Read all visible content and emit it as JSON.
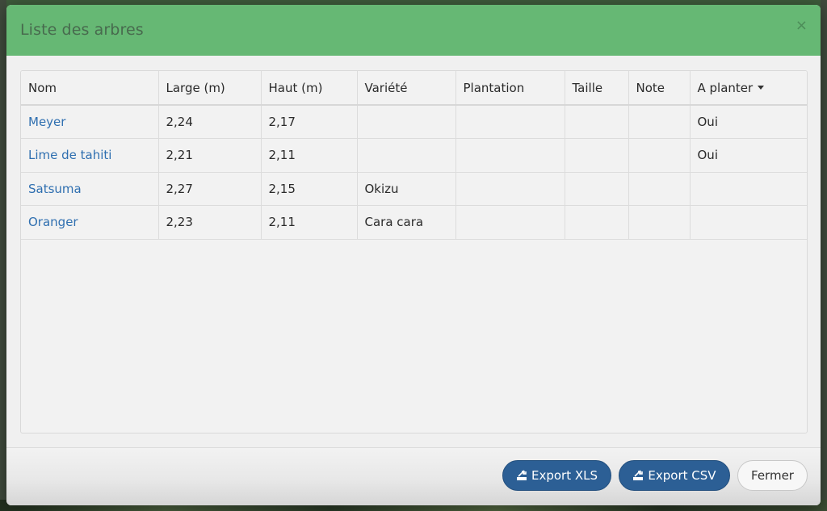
{
  "dialog": {
    "title": "Liste des arbres",
    "close_symbol": "×"
  },
  "table": {
    "columns": [
      "Nom",
      "Large (m)",
      "Haut (m)",
      "Variété",
      "Plantation",
      "Taille",
      "Note",
      "A planter"
    ],
    "sorted_column": "A planter",
    "rows": [
      [
        "Meyer",
        "2,24",
        "2,17",
        "",
        "",
        "",
        "",
        "Oui"
      ],
      [
        "Lime de tahiti",
        "2,21",
        "2,11",
        "",
        "",
        "",
        "",
        "Oui"
      ],
      [
        "Satsuma",
        "2,27",
        "2,15",
        "Okizu",
        "",
        "",
        "",
        ""
      ],
      [
        "Oranger",
        "2,23",
        "2,11",
        "Cara cara",
        "",
        "",
        "",
        ""
      ]
    ]
  },
  "footer": {
    "export_xls_label": "Export XLS",
    "export_csv_label": "Export CSV",
    "close_label": "Fermer"
  },
  "colors": {
    "header_green": "#66b874",
    "link_blue": "#2f6fb0",
    "button_blue": "#2c5f95"
  },
  "icons": {
    "export": "export-icon",
    "sort": "caret-down-icon"
  }
}
